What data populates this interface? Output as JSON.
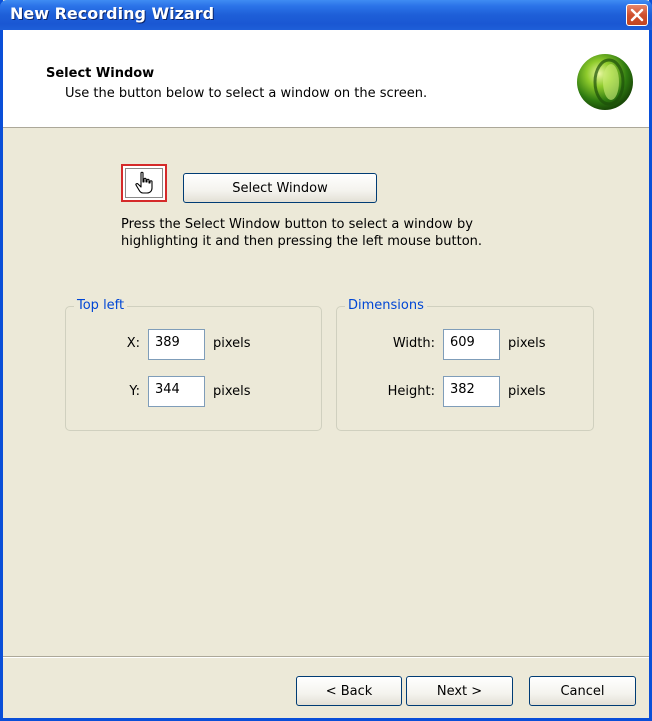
{
  "window": {
    "title": "New Recording Wizard",
    "accent": "#0A4FD8",
    "background": "#ECE9D8"
  },
  "header": {
    "title": "Select Window",
    "subtitle": "Use the button below to select a window on the screen.",
    "logo_icon": "green-orb-logo"
  },
  "picker": {
    "icon": "hand-pointer-icon",
    "button_label": "Select Window",
    "description_line1": "Press the Select Window button to select a window by",
    "description_line2": "highlighting it and then pressing the left mouse button."
  },
  "top_left": {
    "legend": "Top left",
    "x_label": "X:",
    "x_value": "389",
    "x_unit": "pixels",
    "y_label": "Y:",
    "y_value": "344",
    "y_unit": "pixels"
  },
  "dimensions": {
    "legend": "Dimensions",
    "width_label": "Width:",
    "width_value": "609",
    "width_unit": "pixels",
    "height_label": "Height:",
    "height_value": "382",
    "height_unit": "pixels"
  },
  "footer": {
    "back_label": "< Back",
    "next_label": "Next >",
    "cancel_label": "Cancel"
  },
  "colors": {
    "legend_text": "#0046D5",
    "picker_border": "#D52A2A",
    "close_button": "#D0502E"
  }
}
